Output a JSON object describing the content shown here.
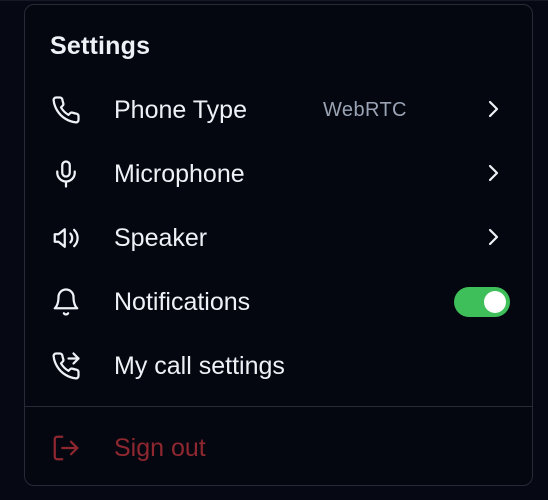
{
  "menu": {
    "title": "Settings",
    "items": [
      {
        "label": "Phone Type",
        "value": "WebRTC",
        "icon": "phone-icon",
        "trailing": "chevron"
      },
      {
        "label": "Microphone",
        "value": "",
        "icon": "microphone-icon",
        "trailing": "chevron"
      },
      {
        "label": "Speaker",
        "value": "",
        "icon": "speaker-icon",
        "trailing": "chevron"
      },
      {
        "label": "Notifications",
        "value": "",
        "icon": "bell-icon",
        "trailing": "toggle"
      },
      {
        "label": "My call settings",
        "value": "",
        "icon": "phone-forward-icon",
        "trailing": "none"
      }
    ],
    "notifications_enabled": true,
    "signout": {
      "label": "Sign out",
      "icon": "sign-out-icon"
    }
  },
  "colors": {
    "background": "#04070f",
    "text": "#eef1f6",
    "muted": "#9aa3b4",
    "toggle_on": "#3fbf5a",
    "danger": "#8f2730",
    "border": "#262b37"
  }
}
